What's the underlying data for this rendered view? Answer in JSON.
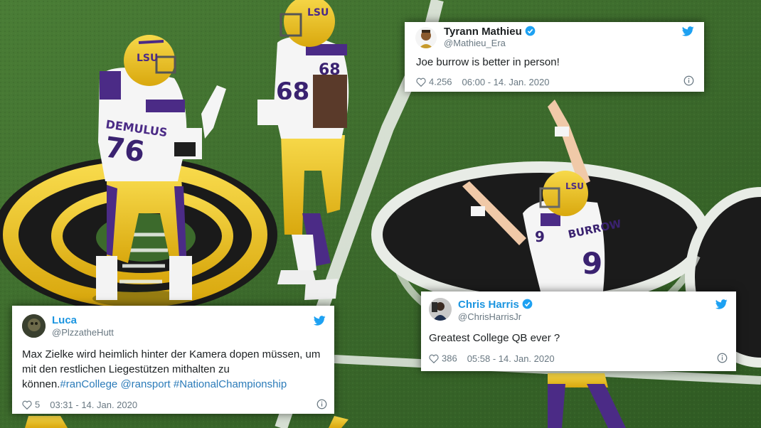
{
  "colors": {
    "twitter_blue": "#1da1f2",
    "link_blue": "#2b7bb9",
    "meta_gray": "#697882",
    "field_green": "#3b6b2c",
    "lsu_gold": "#f1c518",
    "lsu_purple": "#4b2b86"
  },
  "tweets": [
    {
      "name": "Tyrann Mathieu",
      "handle": "@Mathieu_Era",
      "verified": true,
      "text": "Joe burrow is better in person!",
      "likes": "4.256",
      "time": "06:00 - 14. Jan. 2020",
      "icons": {
        "logo": "twitter-bird-icon",
        "verified": "verified-badge-icon",
        "like": "heart-icon",
        "info": "info-icon"
      }
    },
    {
      "name": "Chris Harris",
      "handle": "@ChrisHarrisJr",
      "verified": true,
      "text": "Greatest College QB ever ?",
      "likes": "386",
      "time": "05:58 - 14. Jan. 2020",
      "icons": {
        "logo": "twitter-bird-icon",
        "verified": "verified-badge-icon",
        "like": "heart-icon",
        "info": "info-icon"
      }
    },
    {
      "name": "Luca",
      "handle": "@PlzzatheHutt",
      "verified": false,
      "text_plain": "Max Zielke wird heimlich hinter der Kamera dopen müssen, um mit den restlichen Liegestützen mithalten zu können.",
      "hashtag_1": "#ranCollege",
      "mention": "@ransport",
      "hashtag_2": "#NationalChampionship",
      "likes": "5",
      "time": "03:31 - 14. Jan. 2020",
      "icons": {
        "logo": "twitter-bird-icon",
        "like": "heart-icon",
        "info": "info-icon"
      }
    }
  ],
  "photo": {
    "jersey_left_name": "DEMULUS",
    "jersey_left_number": "76",
    "jersey_mid_number": "68",
    "jersey_right_name": "BURROW",
    "jersey_right_number": "9",
    "helmet_logo": "LSU"
  }
}
